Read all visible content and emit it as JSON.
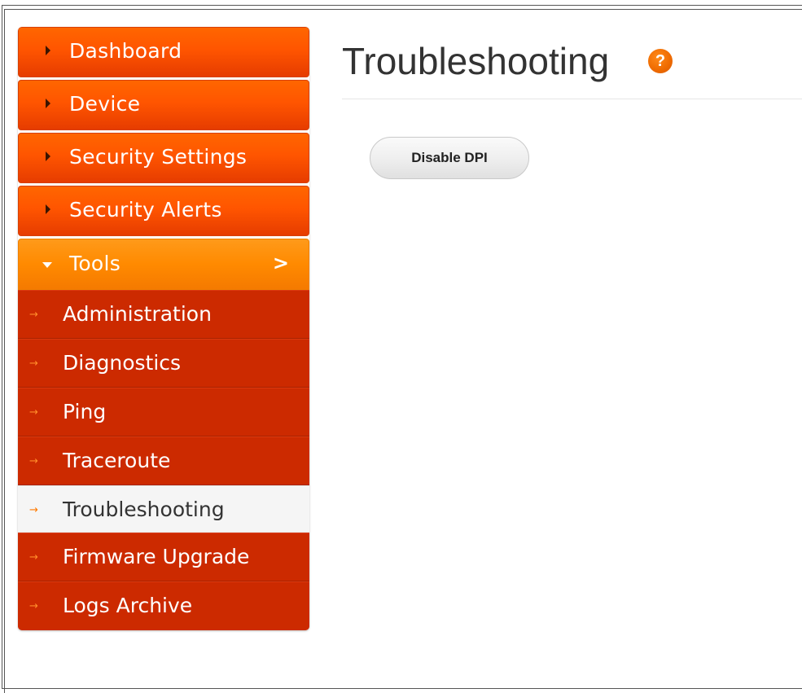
{
  "sidebar": {
    "main_items": [
      {
        "label": "Dashboard",
        "expanded": false
      },
      {
        "label": "Device",
        "expanded": false
      },
      {
        "label": "Security Settings",
        "expanded": false
      },
      {
        "label": "Security Alerts",
        "expanded": false
      }
    ],
    "tools": {
      "label": "Tools",
      "expanded": true,
      "chevron": ">",
      "sub_items": [
        {
          "label": "Administration",
          "active": false
        },
        {
          "label": "Diagnostics",
          "active": false
        },
        {
          "label": "Ping",
          "active": false
        },
        {
          "label": "Traceroute",
          "active": false
        },
        {
          "label": "Troubleshooting",
          "active": true
        },
        {
          "label": "Firmware Upgrade",
          "active": false
        },
        {
          "label": "Logs Archive",
          "active": false
        }
      ],
      "arrow_glyph": "→"
    }
  },
  "main": {
    "title": "Troubleshooting",
    "help_icon_glyph": "?",
    "disable_dpi_label": "Disable DPI"
  },
  "colors": {
    "menu_orange": "#ff5500",
    "tools_orange": "#ff8a00",
    "submenu_red": "#cc2a00",
    "active_bg": "#f5f5f5",
    "help_icon": "#ee6a00"
  }
}
